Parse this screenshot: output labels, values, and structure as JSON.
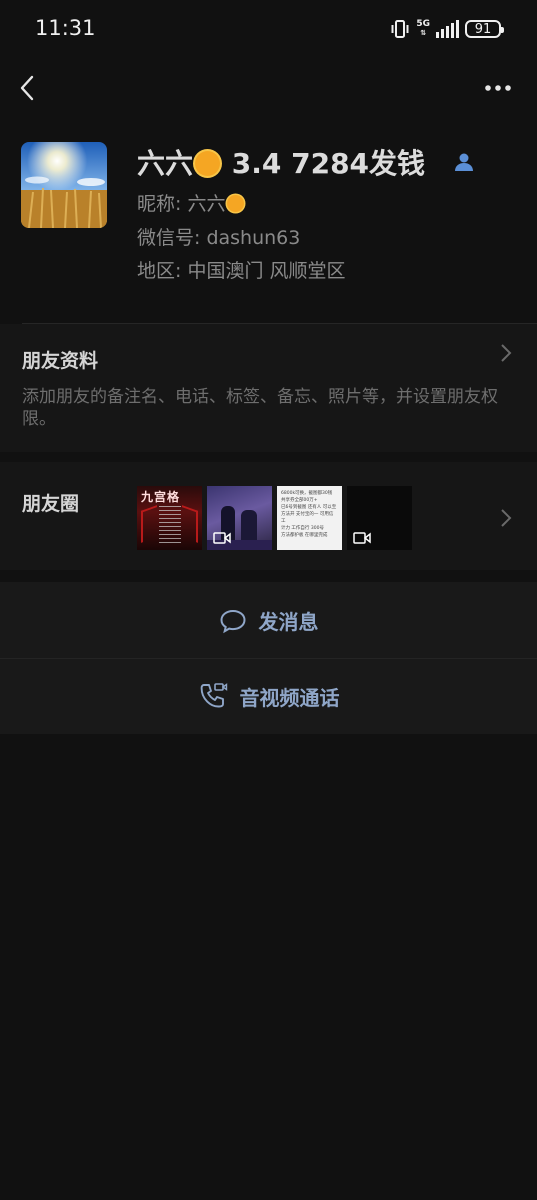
{
  "status_bar": {
    "time": "11:31",
    "network": "5G",
    "battery": "91"
  },
  "profile": {
    "name_prefix": "六六",
    "name_suffix": " 3.4   7284发钱",
    "nickname_label": "昵称: ",
    "nickname_value": "六六",
    "wechat_id": "微信号: dashun63",
    "region": "地区: 中国澳门  风顺堂区"
  },
  "friend_info": {
    "title": "朋友资料",
    "description": "添加朋友的备注名、电话、标签、备忘、照片等，并设置朋友权限。"
  },
  "moments": {
    "title": "朋友圈",
    "thumb1_text": "九宫格",
    "thumb3_lines": [
      "6800k可换，截图都30钱",
      "共享券全部00万+",
      "已6号到截图 还有人 可以至",
      "方法开 支付宝的一 可用信 工",
      "计力 工作自行 300号",
      "方法都护板 在哪里完成"
    ]
  },
  "actions": {
    "message_label": "发消息",
    "call_label": "音视频通话"
  },
  "colors": {
    "background": "#111111",
    "section": "#191919",
    "action_blue": "#8fa6c8",
    "contact_icon": "#5b8fd6"
  }
}
